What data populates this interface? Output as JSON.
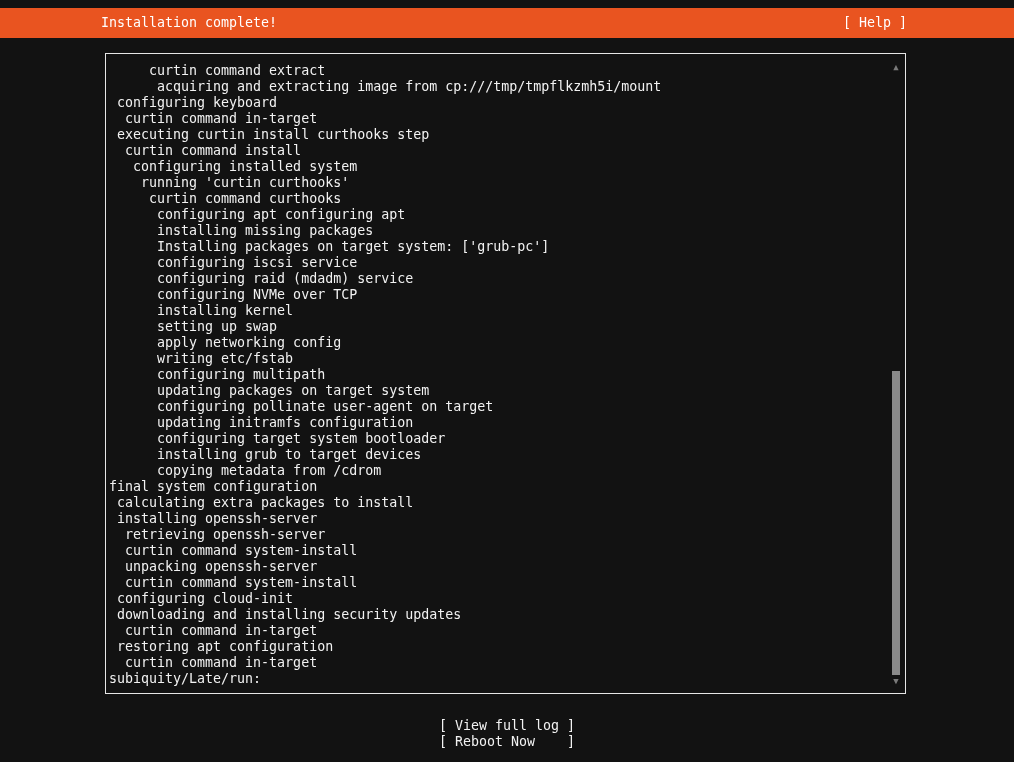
{
  "header": {
    "title": "Installation complete!",
    "help_button": "[ Help ]"
  },
  "log": {
    "lines": [
      "     curtin command extract",
      "      acquiring and extracting image from cp:///tmp/tmpflkzmh5i/mount",
      " configuring keyboard",
      "  curtin command in-target",
      " executing curtin install curthooks step",
      "  curtin command install",
      "   configuring installed system",
      "    running 'curtin curthooks'",
      "     curtin command curthooks",
      "      configuring apt configuring apt",
      "      installing missing packages",
      "      Installing packages on target system: ['grub-pc']",
      "      configuring iscsi service",
      "      configuring raid (mdadm) service",
      "      configuring NVMe over TCP",
      "      installing kernel",
      "      setting up swap",
      "      apply networking config",
      "      writing etc/fstab",
      "      configuring multipath",
      "      updating packages on target system",
      "      configuring pollinate user-agent on target",
      "      updating initramfs configuration",
      "      configuring target system bootloader",
      "      installing grub to target devices",
      "      copying metadata from /cdrom",
      "final system configuration",
      " calculating extra packages to install",
      " installing openssh-server",
      "  retrieving openssh-server",
      "  curtin command system-install",
      "  unpacking openssh-server",
      "  curtin command system-install",
      " configuring cloud-init",
      " downloading and installing security updates",
      "  curtin command in-target",
      " restoring apt configuration",
      "  curtin command in-target",
      "subiquity/Late/run:"
    ],
    "scroll_up": "▲",
    "scroll_down": "▼"
  },
  "buttons": [
    "[ View full log ]",
    "[ Reboot Now    ]"
  ]
}
